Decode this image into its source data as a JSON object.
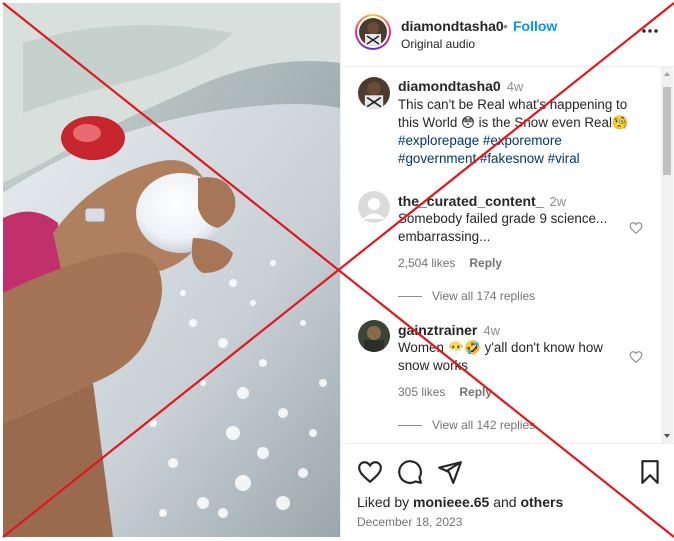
{
  "post": {
    "username": "diamondtasha0",
    "separator": "•",
    "follow_label": "Follow",
    "audio_label": "Original audio",
    "more_icon": "more-options-icon"
  },
  "caption": {
    "username": "diamondtasha0",
    "time": "4w",
    "text": "This can't be Real what's happening to this World 😳 is the Snow even Real🧐",
    "hashtags": "#explorepage #exporemore #government #fakesnow #viral"
  },
  "comments": [
    {
      "username": "the_curated_content_",
      "time": "2w",
      "text": "Somebody failed grade 9 science... embarrassing...",
      "likes": "2,504 likes",
      "reply_label": "Reply",
      "view_replies": "View all 174 replies"
    },
    {
      "username": "gainztrainer",
      "time": "4w",
      "text": "Women 😶‍🌫️🤣 y'all don't know how snow works",
      "likes": "305 likes",
      "reply_label": "Reply",
      "view_replies": "View all 142 replies"
    }
  ],
  "actions": {
    "liked_by_prefix": "Liked by ",
    "liked_by_user": "monieee.65",
    "liked_by_mid": " and ",
    "liked_by_others": "others",
    "date": "December 18, 2023"
  },
  "colors": {
    "accent": "#0095f6",
    "hashtag": "#00376b",
    "overlay_x": "#e3161c"
  }
}
